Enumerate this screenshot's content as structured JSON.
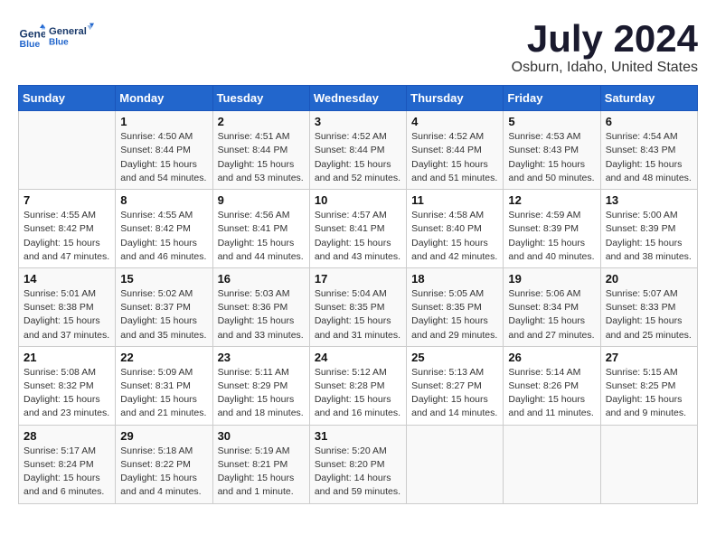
{
  "logo": {
    "line1": "General",
    "line2": "Blue"
  },
  "title": "July 2024",
  "location": "Osburn, Idaho, United States",
  "header": {
    "days": [
      "Sunday",
      "Monday",
      "Tuesday",
      "Wednesday",
      "Thursday",
      "Friday",
      "Saturday"
    ]
  },
  "weeks": [
    [
      {
        "day": "",
        "sunrise": "",
        "sunset": "",
        "daylight": ""
      },
      {
        "day": "1",
        "sunrise": "Sunrise: 4:50 AM",
        "sunset": "Sunset: 8:44 PM",
        "daylight": "Daylight: 15 hours and 54 minutes."
      },
      {
        "day": "2",
        "sunrise": "Sunrise: 4:51 AM",
        "sunset": "Sunset: 8:44 PM",
        "daylight": "Daylight: 15 hours and 53 minutes."
      },
      {
        "day": "3",
        "sunrise": "Sunrise: 4:52 AM",
        "sunset": "Sunset: 8:44 PM",
        "daylight": "Daylight: 15 hours and 52 minutes."
      },
      {
        "day": "4",
        "sunrise": "Sunrise: 4:52 AM",
        "sunset": "Sunset: 8:44 PM",
        "daylight": "Daylight: 15 hours and 51 minutes."
      },
      {
        "day": "5",
        "sunrise": "Sunrise: 4:53 AM",
        "sunset": "Sunset: 8:43 PM",
        "daylight": "Daylight: 15 hours and 50 minutes."
      },
      {
        "day": "6",
        "sunrise": "Sunrise: 4:54 AM",
        "sunset": "Sunset: 8:43 PM",
        "daylight": "Daylight: 15 hours and 48 minutes."
      }
    ],
    [
      {
        "day": "7",
        "sunrise": "Sunrise: 4:55 AM",
        "sunset": "Sunset: 8:42 PM",
        "daylight": "Daylight: 15 hours and 47 minutes."
      },
      {
        "day": "8",
        "sunrise": "Sunrise: 4:55 AM",
        "sunset": "Sunset: 8:42 PM",
        "daylight": "Daylight: 15 hours and 46 minutes."
      },
      {
        "day": "9",
        "sunrise": "Sunrise: 4:56 AM",
        "sunset": "Sunset: 8:41 PM",
        "daylight": "Daylight: 15 hours and 44 minutes."
      },
      {
        "day": "10",
        "sunrise": "Sunrise: 4:57 AM",
        "sunset": "Sunset: 8:41 PM",
        "daylight": "Daylight: 15 hours and 43 minutes."
      },
      {
        "day": "11",
        "sunrise": "Sunrise: 4:58 AM",
        "sunset": "Sunset: 8:40 PM",
        "daylight": "Daylight: 15 hours and 42 minutes."
      },
      {
        "day": "12",
        "sunrise": "Sunrise: 4:59 AM",
        "sunset": "Sunset: 8:39 PM",
        "daylight": "Daylight: 15 hours and 40 minutes."
      },
      {
        "day": "13",
        "sunrise": "Sunrise: 5:00 AM",
        "sunset": "Sunset: 8:39 PM",
        "daylight": "Daylight: 15 hours and 38 minutes."
      }
    ],
    [
      {
        "day": "14",
        "sunrise": "Sunrise: 5:01 AM",
        "sunset": "Sunset: 8:38 PM",
        "daylight": "Daylight: 15 hours and 37 minutes."
      },
      {
        "day": "15",
        "sunrise": "Sunrise: 5:02 AM",
        "sunset": "Sunset: 8:37 PM",
        "daylight": "Daylight: 15 hours and 35 minutes."
      },
      {
        "day": "16",
        "sunrise": "Sunrise: 5:03 AM",
        "sunset": "Sunset: 8:36 PM",
        "daylight": "Daylight: 15 hours and 33 minutes."
      },
      {
        "day": "17",
        "sunrise": "Sunrise: 5:04 AM",
        "sunset": "Sunset: 8:35 PM",
        "daylight": "Daylight: 15 hours and 31 minutes."
      },
      {
        "day": "18",
        "sunrise": "Sunrise: 5:05 AM",
        "sunset": "Sunset: 8:35 PM",
        "daylight": "Daylight: 15 hours and 29 minutes."
      },
      {
        "day": "19",
        "sunrise": "Sunrise: 5:06 AM",
        "sunset": "Sunset: 8:34 PM",
        "daylight": "Daylight: 15 hours and 27 minutes."
      },
      {
        "day": "20",
        "sunrise": "Sunrise: 5:07 AM",
        "sunset": "Sunset: 8:33 PM",
        "daylight": "Daylight: 15 hours and 25 minutes."
      }
    ],
    [
      {
        "day": "21",
        "sunrise": "Sunrise: 5:08 AM",
        "sunset": "Sunset: 8:32 PM",
        "daylight": "Daylight: 15 hours and 23 minutes."
      },
      {
        "day": "22",
        "sunrise": "Sunrise: 5:09 AM",
        "sunset": "Sunset: 8:31 PM",
        "daylight": "Daylight: 15 hours and 21 minutes."
      },
      {
        "day": "23",
        "sunrise": "Sunrise: 5:11 AM",
        "sunset": "Sunset: 8:29 PM",
        "daylight": "Daylight: 15 hours and 18 minutes."
      },
      {
        "day": "24",
        "sunrise": "Sunrise: 5:12 AM",
        "sunset": "Sunset: 8:28 PM",
        "daylight": "Daylight: 15 hours and 16 minutes."
      },
      {
        "day": "25",
        "sunrise": "Sunrise: 5:13 AM",
        "sunset": "Sunset: 8:27 PM",
        "daylight": "Daylight: 15 hours and 14 minutes."
      },
      {
        "day": "26",
        "sunrise": "Sunrise: 5:14 AM",
        "sunset": "Sunset: 8:26 PM",
        "daylight": "Daylight: 15 hours and 11 minutes."
      },
      {
        "day": "27",
        "sunrise": "Sunrise: 5:15 AM",
        "sunset": "Sunset: 8:25 PM",
        "daylight": "Daylight: 15 hours and 9 minutes."
      }
    ],
    [
      {
        "day": "28",
        "sunrise": "Sunrise: 5:17 AM",
        "sunset": "Sunset: 8:24 PM",
        "daylight": "Daylight: 15 hours and 6 minutes."
      },
      {
        "day": "29",
        "sunrise": "Sunrise: 5:18 AM",
        "sunset": "Sunset: 8:22 PM",
        "daylight": "Daylight: 15 hours and 4 minutes."
      },
      {
        "day": "30",
        "sunrise": "Sunrise: 5:19 AM",
        "sunset": "Sunset: 8:21 PM",
        "daylight": "Daylight: 15 hours and 1 minute."
      },
      {
        "day": "31",
        "sunrise": "Sunrise: 5:20 AM",
        "sunset": "Sunset: 8:20 PM",
        "daylight": "Daylight: 14 hours and 59 minutes."
      },
      {
        "day": "",
        "sunrise": "",
        "sunset": "",
        "daylight": ""
      },
      {
        "day": "",
        "sunrise": "",
        "sunset": "",
        "daylight": ""
      },
      {
        "day": "",
        "sunrise": "",
        "sunset": "",
        "daylight": ""
      }
    ]
  ]
}
